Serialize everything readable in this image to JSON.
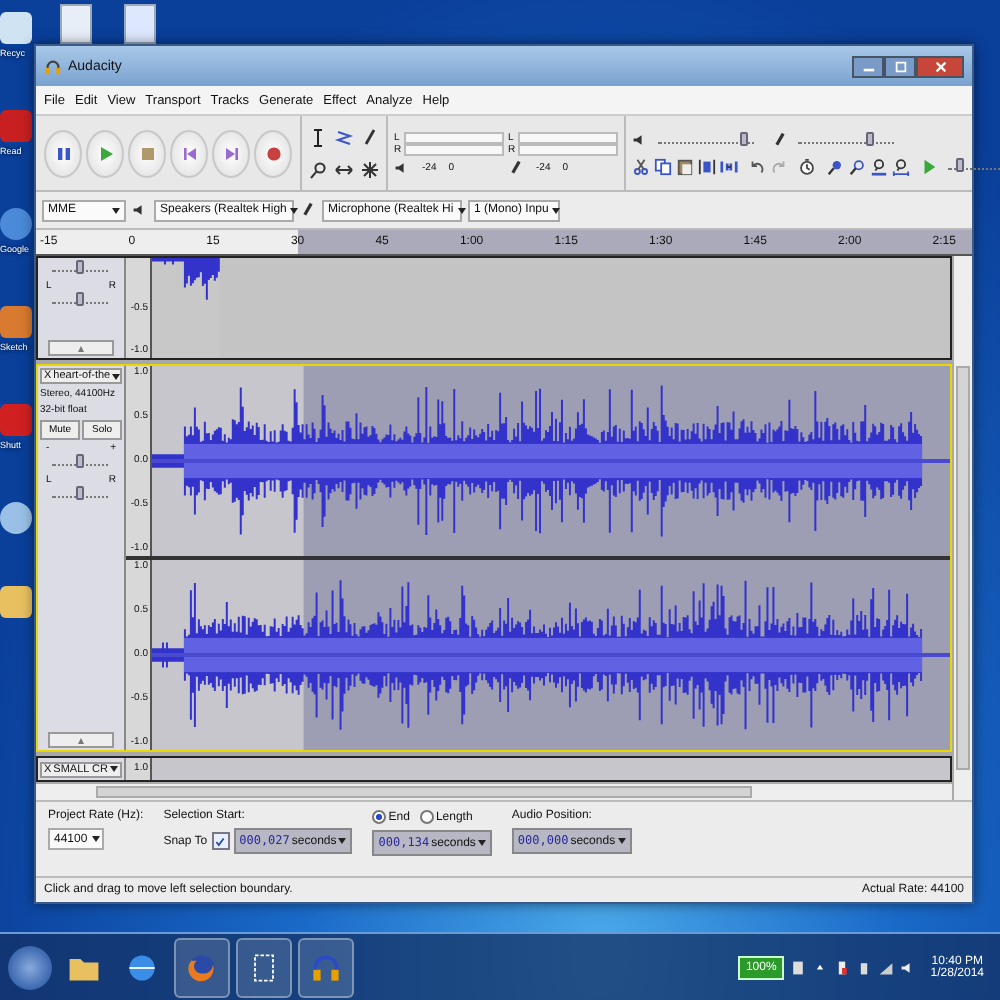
{
  "desktop": {
    "icons": [
      {
        "kind": "recycle",
        "label": "Recyc"
      },
      {
        "kind": "pdf",
        "label": "Read"
      },
      {
        "kind": "globe",
        "label": "Google"
      },
      {
        "kind": "house",
        "label": "Sketch"
      },
      {
        "kind": "red",
        "label": "Shutt"
      },
      {
        "kind": "music"
      },
      {
        "kind": "folder"
      }
    ]
  },
  "window": {
    "title": "Audacity"
  },
  "menu": [
    "File",
    "Edit",
    "View",
    "Transport",
    "Tracks",
    "Generate",
    "Effect",
    "Analyze",
    "Help"
  ],
  "meters": [
    {
      "kind": "playback",
      "channels": [
        "L",
        "R"
      ],
      "ticks": [
        "-24",
        "0"
      ]
    },
    {
      "kind": "recording",
      "channels": [
        "L",
        "R"
      ],
      "ticks": [
        "-24",
        "0"
      ]
    }
  ],
  "mixer": [
    {
      "kind": "output",
      "level": 0.9
    },
    {
      "kind": "input",
      "level": 0.75
    }
  ],
  "play_at_speed": {
    "level": 0.2
  },
  "devices": {
    "host": "MME",
    "output": "Speakers (Realtek High",
    "input": "Microphone (Realtek Hi",
    "channels": "1 (Mono) Inpu"
  },
  "timeline": [
    "-15",
    "0",
    "15",
    "30",
    "45",
    "1:00",
    "1:15",
    "1:30",
    "1:45",
    "2:00",
    "2:15"
  ],
  "tracks": [
    {
      "kind": "partial",
      "selected": false,
      "sliders": [
        {
          "level": 0.5
        },
        {
          "ends": [
            "L",
            "R"
          ],
          "level": 0.5
        }
      ],
      "channels": [
        {
          "scale": [
            "-0.5",
            "-1.0"
          ]
        }
      ]
    },
    {
      "kind": "stereo",
      "selected": true,
      "close": "X",
      "name": "heart-of-the",
      "info": [
        "Stereo, 44100Hz",
        "32-bit float"
      ],
      "buttons": [
        "Mute",
        "Solo"
      ],
      "sliders": [
        {
          "ends": [
            "-",
            "+"
          ],
          "level": 0.5
        },
        {
          "ends": [
            "L",
            "R"
          ],
          "level": 0.5
        }
      ],
      "channels": [
        {
          "scale": [
            "1.0",
            "0.5",
            "0.0",
            "-0.5",
            "-1.0"
          ]
        },
        {
          "scale": [
            "1.0",
            "0.5",
            "0.0",
            "-0.5",
            "-1.0"
          ]
        }
      ]
    },
    {
      "kind": "collapsed",
      "selected": false,
      "close": "X",
      "name": "SMALL CR",
      "channels": [
        {
          "scale": [
            "1.0"
          ]
        }
      ]
    }
  ],
  "selection_toolbar": {
    "project_rate": {
      "label": "Project Rate (Hz):",
      "value": "44100"
    },
    "snap": {
      "label": "Snap To",
      "checked": true
    },
    "start_label": "Selection Start:",
    "modes": [
      {
        "label": "End",
        "selected": true
      },
      {
        "label": "Length",
        "selected": false
      }
    ],
    "position_label": "Audio Position:",
    "times": [
      {
        "value": "000,027",
        "unit": "seconds"
      },
      {
        "value": "000,134",
        "unit": "seconds"
      },
      {
        "value": "000,000",
        "unit": "seconds"
      }
    ]
  },
  "status_bar": {
    "message": "Click and drag to move left selection boundary.",
    "rate": "Actual Rate: 44100"
  },
  "taskbar": {
    "apps": [
      {
        "kind": "folder"
      },
      {
        "kind": "browser"
      },
      {
        "kind": "firefox"
      },
      {
        "kind": "window"
      },
      {
        "kind": "headphones"
      }
    ],
    "battery": "100%",
    "time": "10:40 PM",
    "date": "1/28/2014"
  }
}
